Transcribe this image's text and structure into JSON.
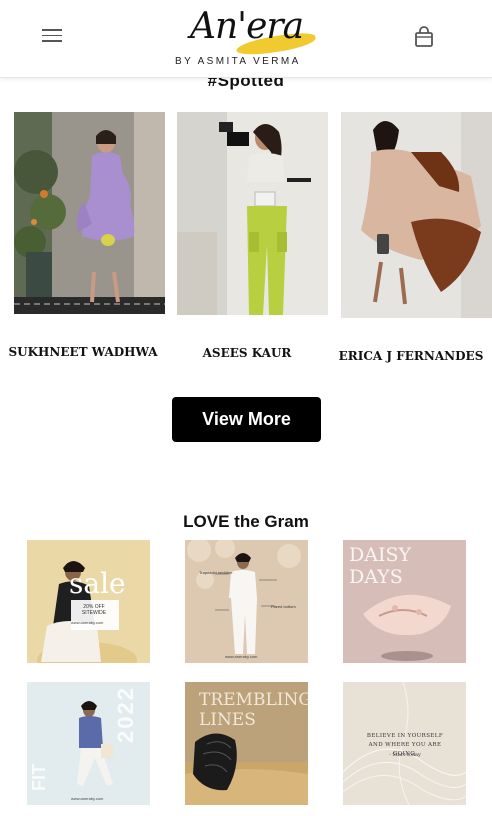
{
  "header": {
    "brand_name": "An'era",
    "brand_sub": "BY ASMITA VERMA"
  },
  "spotted": {
    "title": "#Spotted",
    "people": [
      {
        "name": "SUKHNEET WADHWA"
      },
      {
        "name": "ASEES KAUR"
      },
      {
        "name": "ERICA J FERNANDES"
      }
    ],
    "view_more_label": "View More"
  },
  "gram": {
    "title": "LOVE the Gram",
    "tiles": [
      {
        "text_main": "sale",
        "text_sub": "20% OFF SITEWIDE",
        "caption": "www.aneraby.com"
      },
      {
        "text_main": "Trapezoid neckline",
        "text_sub": "Flared bottom",
        "caption": "www.aneraby.com"
      },
      {
        "text_main": "DAISY DAYS"
      },
      {
        "text_main": "2022",
        "text_sub": "FIT",
        "caption": "www.aneraby.com"
      },
      {
        "text_main": "TREMBLING LINES"
      },
      {
        "text_main": "BELIEVE IN YOURSELF AND WHERE YOU ARE GOING.",
        "text_sub": "- Start today"
      }
    ]
  },
  "colors": {
    "accent_yellow": "#f0c419",
    "button_black": "#000000"
  }
}
